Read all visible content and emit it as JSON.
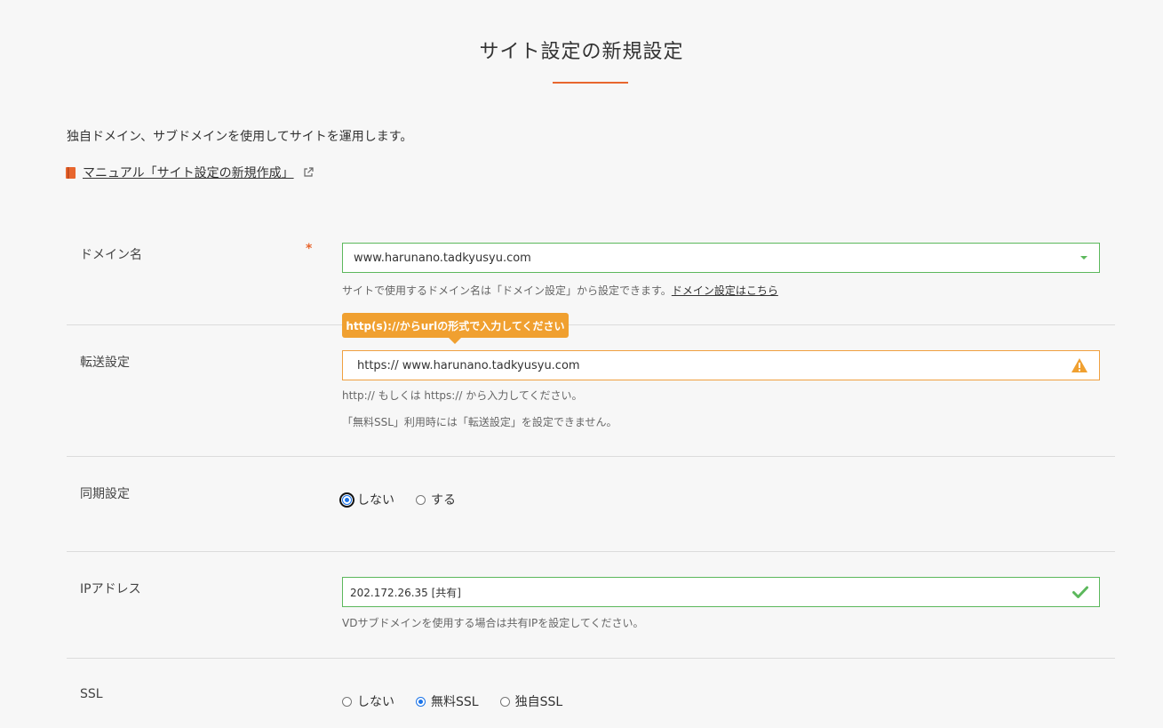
{
  "page": {
    "title": "サイト設定の新規設定",
    "intro": "独自ドメイン、サブドメインを使用してサイトを運用します。",
    "manual_link": "マニュアル「サイト設定の新規作成」"
  },
  "domain": {
    "label": "ドメイン名",
    "required": "*",
    "value": "www.harunano.tadkyusyu.com",
    "help": "サイトで使用するドメイン名は「ドメイン設定」から設定できます。",
    "help_link": "ドメイン設定はこちら"
  },
  "forward": {
    "label": "転送設定",
    "tooltip": "http(s)://からurlの形式で入力してください",
    "value": "https:// www.harunano.tadkyusyu.com",
    "help1": "http:// もしくは https:// から入力してください。",
    "help2": "「無料SSL」利用時には「転送設定」を設定できません。"
  },
  "sync": {
    "label": "同期設定",
    "options": [
      "しない",
      "する"
    ],
    "selected": "しない"
  },
  "ip": {
    "label": "IPアドレス",
    "value": "202.172.26.35 [共有]",
    "help": "VDサブドメインを使用する場合は共有IPを設定してください。"
  },
  "ssl": {
    "label": "SSL",
    "options": [
      "しない",
      "無料SSL",
      "独自SSL"
    ],
    "selected": "無料SSL"
  },
  "colors": {
    "accent": "#e8662e",
    "valid_border": "#5cb85c",
    "warning": "#f0a030",
    "radio_selected": "#1a73e8"
  }
}
